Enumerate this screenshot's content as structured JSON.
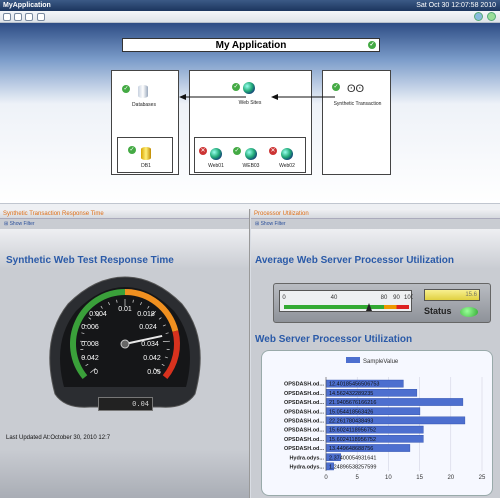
{
  "window": {
    "title": "MyApplication",
    "datetime": "Sat Oct 30 12:07:58 2010"
  },
  "diagram": {
    "title": "My Application",
    "nodes": {
      "databases": "Databases",
      "db1": "DB1",
      "websites": "Web Sites",
      "synthetic": "Synthetic Transaction",
      "web01": "Web01",
      "web03": "WEB03",
      "web02": "Web02"
    }
  },
  "left_panel": {
    "header": "Synthetic Transaction Response Time",
    "filter": "Show Filter",
    "title": "Synthetic Web Test Response Time",
    "digital": "0.04",
    "updated": "Last Updated At:October 30, 2010 12:7",
    "gauge": {
      "ticks_left": [
        "0.004",
        "0.006",
        "0.008",
        "0.042",
        "0"
      ],
      "ticks_right": [
        "0.018",
        "0.024",
        "0.034",
        "0.042",
        "0.05"
      ],
      "top_tick": "0.01",
      "value": 0.04,
      "colors": {
        "green": "#3aa03a",
        "orange": "#f09020",
        "red": "#d8321e"
      }
    }
  },
  "right_panel": {
    "header": "Processor Utilization",
    "filter": "Show Filter",
    "title1": "Average Web Server Processor Utilization",
    "linear_ticks": [
      "0",
      "40",
      "80",
      "90",
      "100"
    ],
    "linear_value": 68,
    "lcd": "15.6",
    "status_label": "Status",
    "title2": "Web Server Processor Utilization",
    "chart_data": {
      "type": "bar",
      "orientation": "horizontal",
      "series": [
        {
          "name": "SampleValue",
          "values": [
            12.4018,
            14.5624,
            21.9406,
            15.0544,
            22.2618,
            15.6024,
            15.6024,
            13.4496,
            2.374,
            1.2489
          ]
        }
      ],
      "categories": [
        "OPSDASH.od...",
        "OPSDASH.od...",
        "OPSDASH.od...",
        "OPSDASH.od...",
        "OPSDASH.od...",
        "OPSDASH.od...",
        "OPSDASH.od...",
        "OPSDASH.od...",
        "Hydra.odys...",
        "Hydra.odys..."
      ],
      "value_labels": [
        "12.40185456506753",
        "14.562432289235",
        "21.9405676166216",
        "15.054418563426",
        "22.261780438493",
        "15.6024118956752",
        "15.6024118956752",
        "13.449648688756",
        "2.37400054931641",
        "1.24896538257599"
      ],
      "xticks": [
        "0",
        "5",
        "10",
        "15",
        "20",
        "25"
      ],
      "xlim": [
        0,
        25
      ],
      "color": "#4d6fcf"
    }
  }
}
